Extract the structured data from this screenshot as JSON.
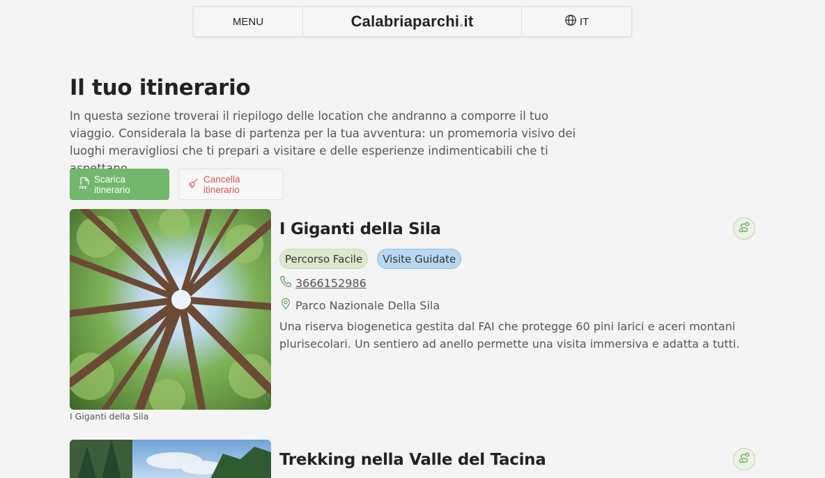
{
  "nav": {
    "menu_label": "MENU",
    "logo_main": "Calabriaparchi",
    "logo_dot": ".",
    "logo_tld": "it",
    "lang_label": "IT",
    "lang_icon": "globe-icon"
  },
  "page": {
    "title": "Il tuo itinerario",
    "intro": "In questa sezione troverai il riepilogo delle location che andranno a comporre il tuo viaggio. Considerala la base di partenza per la tua avventura: un promemoria visivo dei luoghi meravigliosi che ti prepari a visitare e delle esperienze indimenticabili che ti aspettano."
  },
  "actions": {
    "download_label": "Scarica itinerario",
    "download_icon": "pdf-file-icon",
    "cancel_label": "Cancella itinerario",
    "cancel_icon": "broom-icon"
  },
  "colors": {
    "accent_green": "#72b86c",
    "danger_red": "#d9534f",
    "badge_green": "#dde8cd",
    "badge_blue": "#b7d8f0"
  },
  "items": [
    {
      "title": "I Giganti della Sila",
      "caption": "I Giganti della Sila",
      "badges": [
        "Percorso Facile",
        "Visite Guidate"
      ],
      "phone": "3666152986",
      "location": "Parco Nazionale Della Sila",
      "description": "Una riserva biogenetica gestita dal FAI che protegge 60 pini larici e aceri montani plurisecolari. Un sentiero ad anello permette una visita immersiva e adatta a tutti.",
      "route_icon": "route-icon"
    },
    {
      "title": "Trekking nella Valle del Tacina",
      "route_icon": "route-icon"
    }
  ]
}
